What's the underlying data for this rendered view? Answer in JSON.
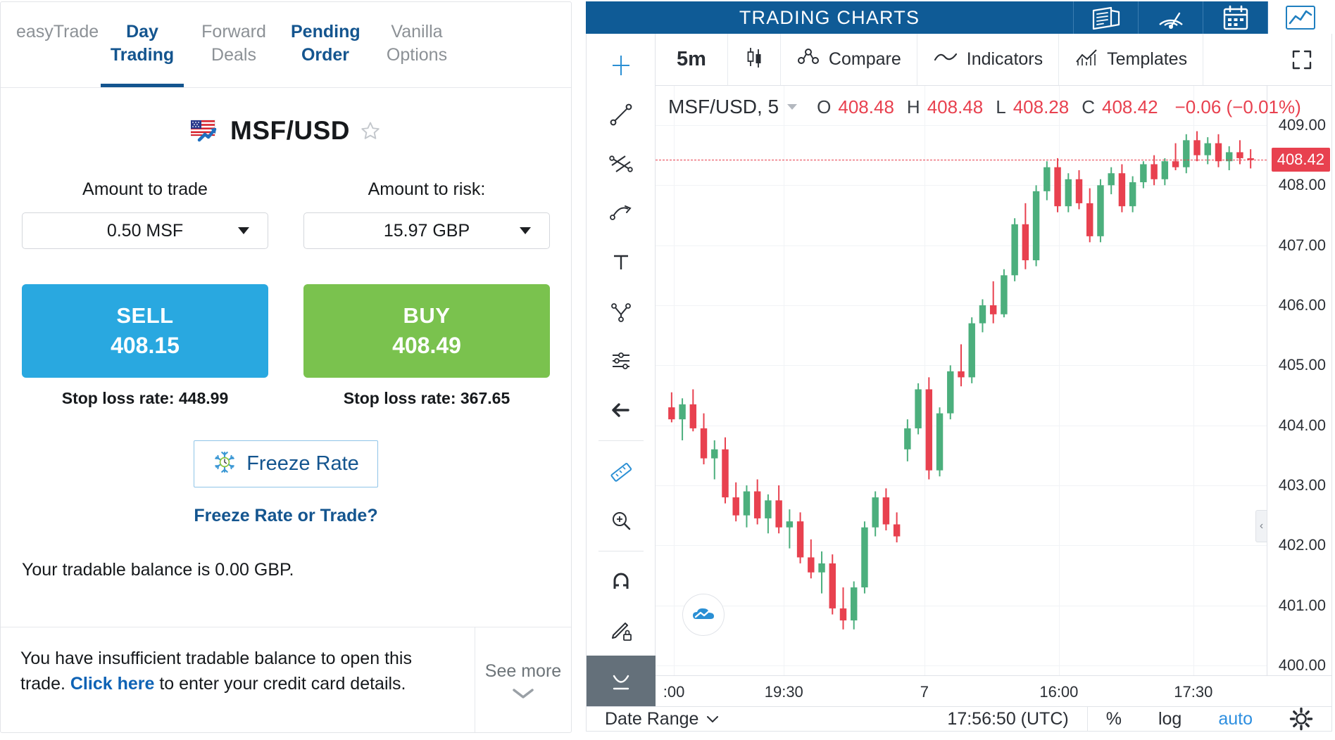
{
  "trade_panel": {
    "tabs": [
      {
        "label": "easyTrade",
        "state": "inactive"
      },
      {
        "label": "Day Trading",
        "state": "active"
      },
      {
        "label": "Forward Deals",
        "state": "inactive"
      },
      {
        "label": "Pending Order",
        "state": "link"
      },
      {
        "label": "Vanilla Options",
        "state": "inactive"
      }
    ],
    "symbol": {
      "name": "MSF/USD",
      "flag_icon": "us-flag-trend-icon",
      "favorite_icon": "star-outline-icon"
    },
    "amount_to_trade": {
      "label": "Amount to trade",
      "value": "0.50 MSF",
      "caret_icon": "chevron-down-icon"
    },
    "amount_to_risk": {
      "label": "Amount to risk:",
      "value": "15.97 GBP",
      "caret_icon": "chevron-down-icon"
    },
    "sell": {
      "label": "SELL",
      "rate": "408.15",
      "stop_loss": "Stop loss rate: 448.99",
      "color": "#29a8e0"
    },
    "buy": {
      "label": "BUY",
      "rate": "408.49",
      "stop_loss": "Stop loss rate: 367.65",
      "color": "#7ac24e"
    },
    "freeze": {
      "button_label": "Freeze Rate",
      "icon": "snowflake-clock-icon",
      "link_label": "Freeze Rate or Trade?"
    },
    "balance_text": "Your tradable balance is 0.00 GBP.",
    "warning": {
      "prefix": "You have insufficient tradable balance to open this trade. ",
      "link": "Click here",
      "suffix": " to enter your credit card details."
    },
    "see_more": {
      "label": "See more",
      "icon": "chevron-down-icon"
    }
  },
  "chart_panel": {
    "header": {
      "title": "TRADING CHARTS",
      "buttons": [
        {
          "name": "news-icon",
          "active": false
        },
        {
          "name": "radar-signal-icon",
          "active": false
        },
        {
          "name": "calendar-icon",
          "active": false
        },
        {
          "name": "line-chart-icon",
          "active": true
        }
      ]
    },
    "left_tools": [
      {
        "name": "crosshair-icon"
      },
      {
        "name": "trend-line-icon"
      },
      {
        "name": "fib-fork-icon"
      },
      {
        "name": "pitchfork-icon"
      },
      {
        "name": "text-tool-icon"
      },
      {
        "name": "pattern-icon"
      },
      {
        "name": "forecast-icon"
      },
      {
        "name": "arrow-left-icon"
      },
      {
        "name": "ruler-icon"
      },
      {
        "name": "zoom-in-icon"
      },
      {
        "name": "magnet-icon"
      },
      {
        "name": "lock-draw-icon"
      },
      {
        "name": "hide-drawings-icon"
      }
    ],
    "toolbar": {
      "interval": "5m",
      "chart_type_icon": "candlestick-icon",
      "compare": "Compare",
      "compare_icon": "compare-icon",
      "indicators": "Indicators",
      "indicators_icon": "indicator-wave-icon",
      "templates": "Templates",
      "templates_icon": "templates-icon",
      "fullscreen_icon": "fullscreen-icon"
    },
    "legend": {
      "symbol": "MSF/USD, 5",
      "caret_icon": "chevron-down-icon",
      "o_label": "O",
      "o_value": "408.48",
      "h_label": "H",
      "h_value": "408.48",
      "l_label": "L",
      "l_value": "408.28",
      "c_label": "C",
      "c_value": "408.42",
      "change": "−0.06 (−0.01%)",
      "change_color": "#e8414f"
    },
    "current_price_badge": "408.42",
    "logo_icon": "cloud-chart-logo-icon",
    "collapse_icon": "chevron-left-icon",
    "footer": {
      "date_range": "Date Range",
      "date_range_icon": "chevron-down-icon",
      "clock": "17:56:50 (UTC)",
      "percent": "%",
      "log": "log",
      "auto": "auto",
      "settings_icon": "gear-icon"
    }
  },
  "chart_data": {
    "type": "candlestick",
    "title": "MSF/USD, 5",
    "interval": "5m",
    "xlabel": "",
    "ylabel": "",
    "ylim": [
      400.0,
      409.0
    ],
    "y_ticks": [
      "409.00",
      "408.00",
      "407.00",
      "406.00",
      "405.00",
      "404.00",
      "403.00",
      "402.00",
      "401.00",
      "400.00"
    ],
    "x_ticks": [
      ":00",
      "19:30",
      "7",
      "16:00",
      "17:30"
    ],
    "grid": true,
    "up_color": "#4caf7d",
    "down_color": "#e8414f",
    "current_price": 408.42,
    "candles": [
      {
        "o": 404.3,
        "h": 404.55,
        "l": 404.05,
        "c": 404.1
      },
      {
        "o": 404.1,
        "h": 404.45,
        "l": 403.75,
        "c": 404.35
      },
      {
        "o": 404.35,
        "h": 404.6,
        "l": 403.9,
        "c": 403.95
      },
      {
        "o": 403.95,
        "h": 404.2,
        "l": 403.35,
        "c": 403.45
      },
      {
        "o": 403.45,
        "h": 403.75,
        "l": 403.1,
        "c": 403.6
      },
      {
        "o": 403.6,
        "h": 403.8,
        "l": 402.7,
        "c": 402.8
      },
      {
        "o": 402.8,
        "h": 403.05,
        "l": 402.4,
        "c": 402.5
      },
      {
        "o": 402.5,
        "h": 403.0,
        "l": 402.3,
        "c": 402.9
      },
      {
        "o": 402.9,
        "h": 403.1,
        "l": 402.35,
        "c": 402.45
      },
      {
        "o": 402.45,
        "h": 402.85,
        "l": 402.2,
        "c": 402.75
      },
      {
        "o": 402.75,
        "h": 403.0,
        "l": 402.2,
        "c": 402.3
      },
      {
        "o": 402.3,
        "h": 402.6,
        "l": 401.95,
        "c": 402.4
      },
      {
        "o": 402.4,
        "h": 402.55,
        "l": 401.7,
        "c": 401.8
      },
      {
        "o": 401.8,
        "h": 402.1,
        "l": 401.45,
        "c": 401.55
      },
      {
        "o": 401.55,
        "h": 401.9,
        "l": 401.2,
        "c": 401.7
      },
      {
        "o": 401.7,
        "h": 401.85,
        "l": 400.85,
        "c": 400.95
      },
      {
        "o": 400.95,
        "h": 401.3,
        "l": 400.6,
        "c": 400.75
      },
      {
        "o": 400.75,
        "h": 401.4,
        "l": 400.6,
        "c": 401.3
      },
      {
        "o": 401.3,
        "h": 402.4,
        "l": 401.2,
        "c": 402.3
      },
      {
        "o": 402.3,
        "h": 402.9,
        "l": 402.15,
        "c": 402.8
      },
      {
        "o": 402.8,
        "h": 402.95,
        "l": 402.25,
        "c": 402.35
      },
      {
        "o": 402.35,
        "h": 402.55,
        "l": 402.05,
        "c": 402.15
      },
      {
        "o": 403.6,
        "h": 404.1,
        "l": 403.4,
        "c": 403.95
      },
      {
        "o": 403.95,
        "h": 404.7,
        "l": 403.85,
        "c": 404.6
      },
      {
        "o": 404.6,
        "h": 404.8,
        "l": 403.1,
        "c": 403.25
      },
      {
        "o": 403.25,
        "h": 404.3,
        "l": 403.15,
        "c": 404.2
      },
      {
        "o": 404.2,
        "h": 405.0,
        "l": 404.1,
        "c": 404.9
      },
      {
        "o": 404.9,
        "h": 405.35,
        "l": 404.65,
        "c": 404.8
      },
      {
        "o": 404.8,
        "h": 405.8,
        "l": 404.7,
        "c": 405.7
      },
      {
        "o": 405.7,
        "h": 406.1,
        "l": 405.55,
        "c": 406.0
      },
      {
        "o": 406.0,
        "h": 406.4,
        "l": 405.7,
        "c": 405.85
      },
      {
        "o": 405.85,
        "h": 406.6,
        "l": 405.8,
        "c": 406.5
      },
      {
        "o": 406.5,
        "h": 407.45,
        "l": 406.4,
        "c": 407.35
      },
      {
        "o": 407.35,
        "h": 407.7,
        "l": 406.6,
        "c": 406.75
      },
      {
        "o": 406.75,
        "h": 408.0,
        "l": 406.65,
        "c": 407.9
      },
      {
        "o": 407.9,
        "h": 408.4,
        "l": 407.75,
        "c": 408.3
      },
      {
        "o": 408.3,
        "h": 408.45,
        "l": 407.55,
        "c": 407.65
      },
      {
        "o": 407.65,
        "h": 408.2,
        "l": 407.55,
        "c": 408.1
      },
      {
        "o": 408.1,
        "h": 408.25,
        "l": 407.6,
        "c": 407.7
      },
      {
        "o": 407.7,
        "h": 407.95,
        "l": 407.05,
        "c": 407.15
      },
      {
        "o": 407.15,
        "h": 408.1,
        "l": 407.05,
        "c": 408.0
      },
      {
        "o": 408.0,
        "h": 408.3,
        "l": 407.85,
        "c": 408.2
      },
      {
        "o": 408.2,
        "h": 408.35,
        "l": 407.55,
        "c": 407.65
      },
      {
        "o": 407.65,
        "h": 408.15,
        "l": 407.55,
        "c": 408.05
      },
      {
        "o": 408.05,
        "h": 408.4,
        "l": 407.95,
        "c": 408.35
      },
      {
        "o": 408.35,
        "h": 408.5,
        "l": 408.0,
        "c": 408.1
      },
      {
        "o": 408.1,
        "h": 408.45,
        "l": 408.0,
        "c": 408.4
      },
      {
        "o": 408.4,
        "h": 408.7,
        "l": 408.25,
        "c": 408.3
      },
      {
        "o": 408.3,
        "h": 408.85,
        "l": 408.2,
        "c": 408.75
      },
      {
        "o": 408.75,
        "h": 408.9,
        "l": 408.4,
        "c": 408.5
      },
      {
        "o": 408.5,
        "h": 408.8,
        "l": 408.35,
        "c": 408.7
      },
      {
        "o": 408.7,
        "h": 408.85,
        "l": 408.3,
        "c": 408.4
      },
      {
        "o": 408.4,
        "h": 408.65,
        "l": 408.25,
        "c": 408.55
      },
      {
        "o": 408.55,
        "h": 408.75,
        "l": 408.35,
        "c": 408.45
      },
      {
        "o": 408.45,
        "h": 408.6,
        "l": 408.28,
        "c": 408.42
      }
    ]
  }
}
